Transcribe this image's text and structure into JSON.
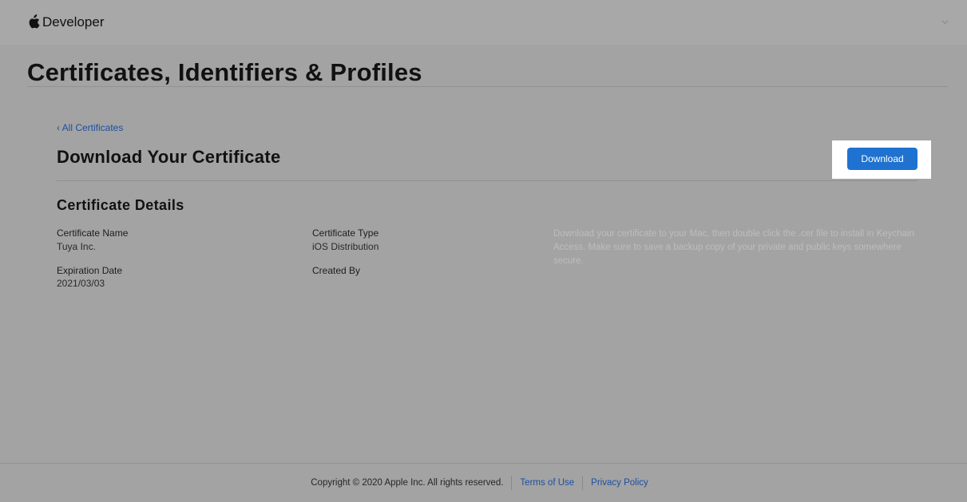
{
  "header": {
    "brand": "Developer",
    "brand_icon": "apple-logo-icon",
    "menu_icon": "chevron-down-icon"
  },
  "page": {
    "title": "Certificates, Identifiers & Profiles"
  },
  "back_link": "‹ All Certificates",
  "section": {
    "title": "Download Your Certificate",
    "download_label": "Download",
    "accent_color": "#1f72d0"
  },
  "details": {
    "title": "Certificate Details",
    "certificate_name_label": "Certificate Name",
    "certificate_name_value": "Tuya Inc.",
    "certificate_type_label": "Certificate Type",
    "certificate_type_value": "iOS Distribution",
    "expiration_date_label": "Expiration Date",
    "expiration_date_value": "2021/03/03",
    "created_by_label": "Created By",
    "created_by_value": "",
    "help_text": "Download your certificate to your Mac, then double click the .cer file to install in Keychain Access. Make sure to save a backup copy of your private and public keys somewhere secure."
  },
  "footer": {
    "copyright": "Copyright © 2020 Apple Inc. All rights reserved.",
    "terms_label": "Terms of Use",
    "privacy_label": "Privacy Policy"
  }
}
